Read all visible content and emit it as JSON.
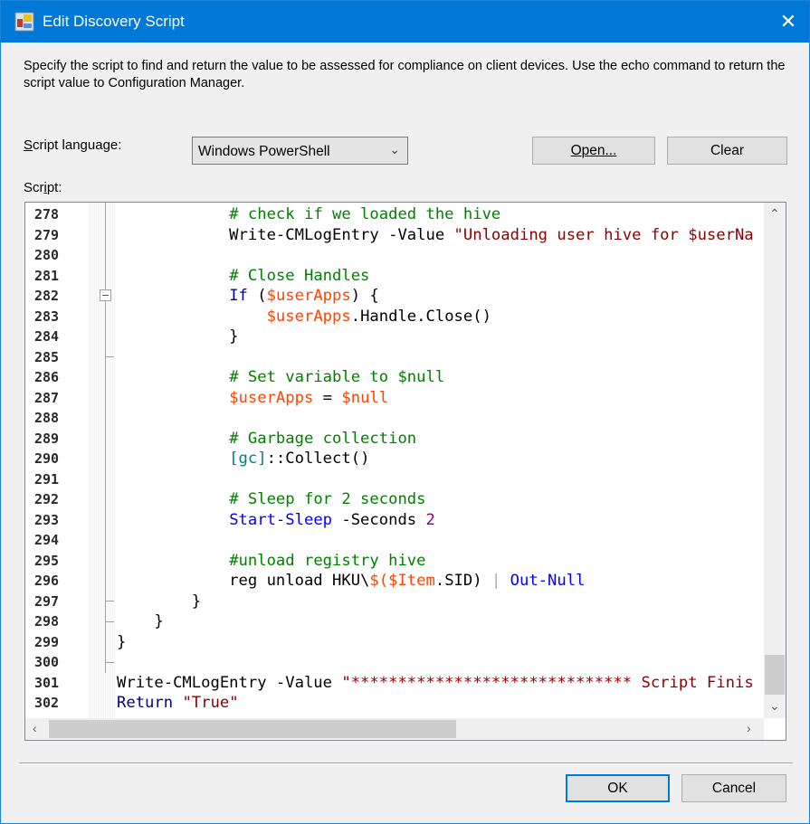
{
  "window": {
    "title": "Edit Discovery Script",
    "close_label": "✕"
  },
  "description": "Specify the script to find and return the value to be assessed for compliance on client devices. Use the echo command to return the script value to Configuration Manager.",
  "script_language": {
    "label_pre": "",
    "label_u": "S",
    "label_post": "cript language:",
    "selected": "Windows PowerShell"
  },
  "buttons": {
    "open": "Open...",
    "clear": "Clear",
    "ok": "OK",
    "cancel": "Cancel"
  },
  "script_label": {
    "pre": "Scr",
    "u": "i",
    "post": "pt:"
  },
  "colors": {
    "titlebar": "#0078d7",
    "c": "#008000",
    "s": "#8b0000",
    "v": "#ff4500",
    "cmd": "#0000ff",
    "kw": "#00008b",
    "p": "#000000",
    "o": "#a9a9a9",
    "n": "#800080",
    "t": "#008080",
    "param": "#000080"
  },
  "editor": {
    "lines": [
      {
        "n": "278",
        "t": [
          [
            "            ",
            "p"
          ],
          [
            "# check if we loaded the hive",
            "c"
          ]
        ]
      },
      {
        "n": "279",
        "t": [
          [
            "            Write-CMLogEntry ",
            "p"
          ],
          [
            "-Value ",
            "p"
          ],
          [
            "\"Unloading user hive for $userNa",
            "s"
          ]
        ]
      },
      {
        "n": "280",
        "t": []
      },
      {
        "n": "281",
        "t": [
          [
            "            ",
            "p"
          ],
          [
            "# Close Handles",
            "c"
          ]
        ]
      },
      {
        "n": "282",
        "t": [
          [
            "            ",
            "p"
          ],
          [
            "If",
            "kw"
          ],
          [
            " (",
            "p"
          ],
          [
            "$userApps",
            "v"
          ],
          [
            ") {",
            "p"
          ]
        ]
      },
      {
        "n": "283",
        "t": [
          [
            "                ",
            "p"
          ],
          [
            "$userApps",
            "v"
          ],
          [
            ".Handle.Close()",
            "p"
          ]
        ]
      },
      {
        "n": "284",
        "t": [
          [
            "            }",
            "p"
          ]
        ]
      },
      {
        "n": "285",
        "t": []
      },
      {
        "n": "286",
        "t": [
          [
            "            ",
            "p"
          ],
          [
            "# Set variable to $null",
            "c"
          ]
        ]
      },
      {
        "n": "287",
        "t": [
          [
            "            ",
            "p"
          ],
          [
            "$userApps",
            "v"
          ],
          [
            " = ",
            "p"
          ],
          [
            "$null",
            "v"
          ]
        ]
      },
      {
        "n": "288",
        "t": []
      },
      {
        "n": "289",
        "t": [
          [
            "            ",
            "p"
          ],
          [
            "# Garbage collection",
            "c"
          ]
        ]
      },
      {
        "n": "290",
        "t": [
          [
            "            ",
            "p"
          ],
          [
            "[gc]",
            "t"
          ],
          [
            "::Collect()",
            "p"
          ]
        ]
      },
      {
        "n": "291",
        "t": []
      },
      {
        "n": "292",
        "t": [
          [
            "            ",
            "p"
          ],
          [
            "# Sleep for 2 seconds",
            "c"
          ]
        ]
      },
      {
        "n": "293",
        "t": [
          [
            "            ",
            "p"
          ],
          [
            "Start-Sleep",
            "cmd"
          ],
          [
            " -Seconds ",
            "p"
          ],
          [
            "2",
            "n"
          ]
        ]
      },
      {
        "n": "294",
        "t": []
      },
      {
        "n": "295",
        "t": [
          [
            "            ",
            "p"
          ],
          [
            "#unload registry hive",
            "c"
          ]
        ]
      },
      {
        "n": "296",
        "t": [
          [
            "            reg unload HKU\\",
            "p"
          ],
          [
            "$(",
            "v"
          ],
          [
            "$Item",
            "v"
          ],
          [
            ".SID) ",
            "p"
          ],
          [
            "| ",
            "o"
          ],
          [
            "Out-Null",
            "cmd"
          ]
        ]
      },
      {
        "n": "297",
        "t": [
          [
            "        }",
            "p"
          ]
        ]
      },
      {
        "n": "298",
        "t": [
          [
            "    }",
            "p"
          ]
        ]
      },
      {
        "n": "299",
        "t": [
          [
            "}",
            "p"
          ]
        ]
      },
      {
        "n": "300",
        "t": []
      },
      {
        "n": "301",
        "t": [
          [
            "Write-CMLogEntry -Value ",
            "p"
          ],
          [
            "\"****************************** Script Finis",
            "s"
          ]
        ]
      },
      {
        "n": "302",
        "t": [
          [
            "Return",
            "kw"
          ],
          [
            " ",
            "p"
          ],
          [
            "\"True\"",
            "s"
          ]
        ]
      }
    ]
  },
  "scroll": {
    "vertical_position_pct": 95,
    "horizontal_position_pct": 0
  }
}
